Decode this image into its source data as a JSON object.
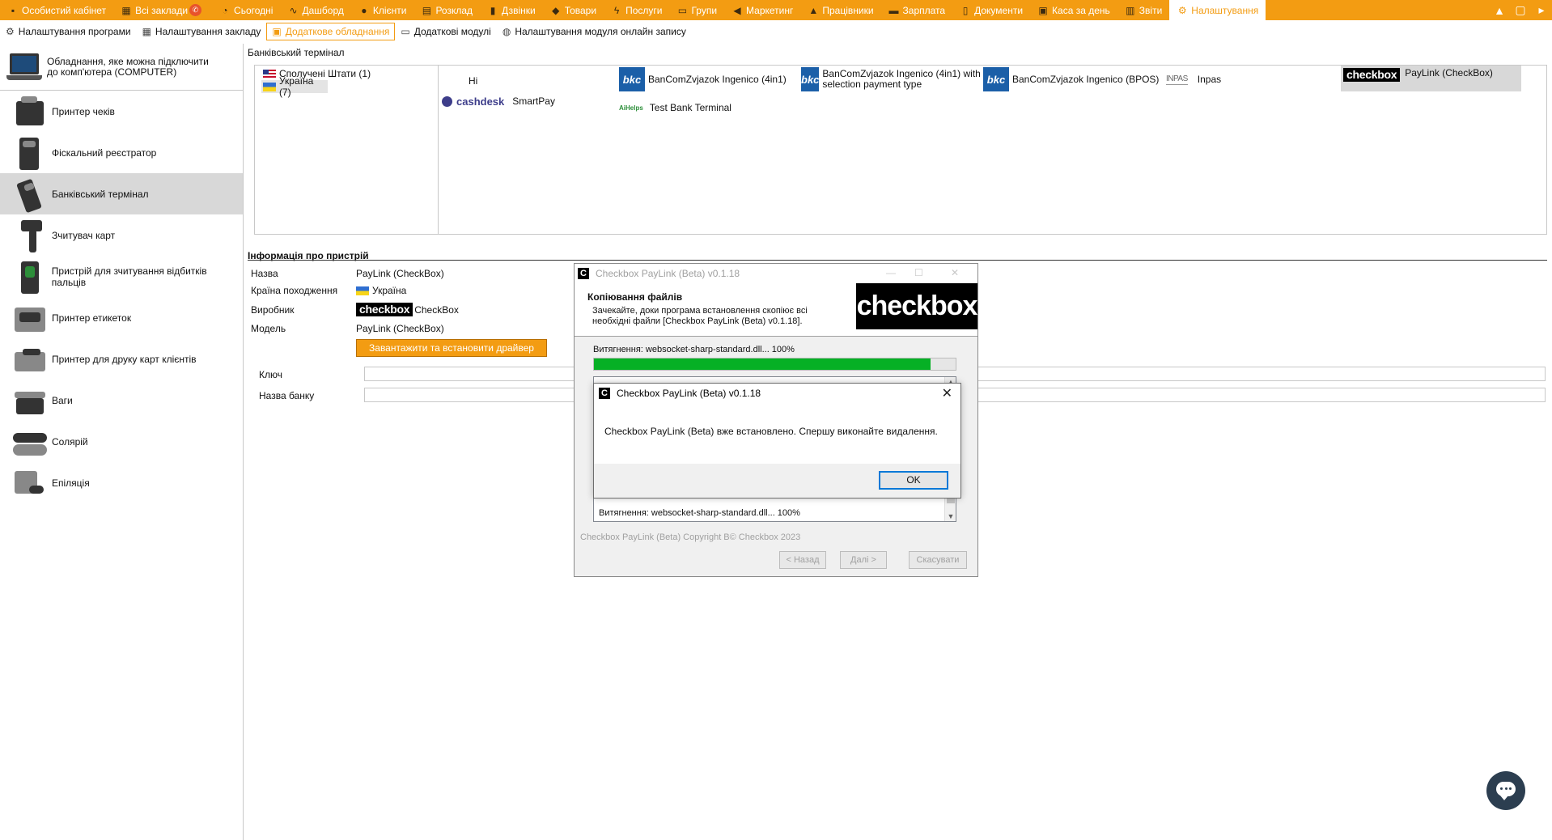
{
  "topnav": {
    "items": [
      {
        "label": "Особистий кабінет",
        "icon": "briefcase-icon"
      },
      {
        "label": "Всі заклади",
        "icon": "grid-icon"
      },
      {
        "label": "Сьогодні",
        "icon": "clock-icon"
      },
      {
        "label": "Дашборд",
        "icon": "pulse-icon"
      },
      {
        "label": "Клієнти",
        "icon": "user-icon"
      },
      {
        "label": "Розклад",
        "icon": "calendar-icon"
      },
      {
        "label": "Дзвінки",
        "icon": "phone-icon"
      },
      {
        "label": "Товари",
        "icon": "box-icon"
      },
      {
        "label": "Послуги",
        "icon": "bolt-icon"
      },
      {
        "label": "Групи",
        "icon": "folder-icon"
      },
      {
        "label": "Маркетинг",
        "icon": "megaphone-icon"
      },
      {
        "label": "Працівники",
        "icon": "person-icon"
      },
      {
        "label": "Зарплата",
        "icon": "money-icon"
      },
      {
        "label": "Документи",
        "icon": "document-icon"
      },
      {
        "label": "Каса за день",
        "icon": "calculator-icon"
      },
      {
        "label": "Звіти",
        "icon": "bar-chart-icon"
      },
      {
        "label": "Налаштування",
        "icon": "gear-icon"
      }
    ],
    "active_index": 16,
    "accent": "#f39c12"
  },
  "subnav": {
    "tabs": [
      {
        "label": "Налаштування програми",
        "icon": "gear-icon"
      },
      {
        "label": "Налаштування закладу",
        "icon": "table-icon"
      },
      {
        "label": "Додаткове обладнання",
        "icon": "printer-icon"
      },
      {
        "label": "Додаткові модулі",
        "icon": "module-icon"
      },
      {
        "label": "Налаштування модуля онлайн запису",
        "icon": "globe-icon"
      }
    ],
    "active_index": 2
  },
  "left": {
    "computer_label": "Обладнання, яке можна підключити до комп'ютера (COMPUTER)",
    "devices": [
      {
        "label": "Принтер чеків",
        "icon": "receipt-printer-icon"
      },
      {
        "label": "Фіскальний реєстратор",
        "icon": "fiscal-register-icon"
      },
      {
        "label": "Банківський термінал",
        "icon": "bank-terminal-icon"
      },
      {
        "label": "Зчитувач карт",
        "icon": "card-reader-icon"
      },
      {
        "label": "Пристрій для зчитування відбитків пальців",
        "icon": "fingerprint-reader-icon"
      },
      {
        "label": "Принтер етикеток",
        "icon": "label-printer-icon"
      },
      {
        "label": "Принтер для друку карт клієнтів",
        "icon": "card-printer-icon"
      },
      {
        "label": "Ваги",
        "icon": "scales-icon"
      },
      {
        "label": "Солярій",
        "icon": "solarium-icon"
      },
      {
        "label": "Епіляція",
        "icon": "epilation-icon"
      }
    ],
    "selected_index": 2
  },
  "main": {
    "section_title": "Банківський термінал",
    "countries": [
      {
        "label": "Сполучені Штати (1)",
        "flag": "us"
      },
      {
        "label": "Україна (7)",
        "flag": "ua"
      }
    ],
    "modules": {
      "hi": "Hi",
      "bkc1": "BanComZvjazok Ingenico (4in1)",
      "bkc2": "BanComZvjazok Ingenico (4in1) with selection payment type",
      "bkc3": "BanComZvjazok Ingenico (BPOS)",
      "inpas_logo": "INPAS",
      "inpas": "Inpas",
      "checkbox_logo": "checkbox",
      "checkbox": "PayLink (CheckBox)",
      "cashdesk_logo": "cashdesk",
      "smartpay": "SmartPay",
      "aihelps_logo": "AiHelps",
      "test": "Test Bank Terminal",
      "bkc_logo": "bkc"
    },
    "info": {
      "title": "Інформація про пристрій",
      "name_label": "Назва",
      "name_value": "PayLink (CheckBox)",
      "country_label": "Країна походження",
      "country_value": "Україна",
      "vendor_label": "Виробник",
      "vendor_logo": "checkbox",
      "vendor_value": "CheckBox",
      "model_label": "Модель",
      "model_value": "PayLink (CheckBox)",
      "driver_button": "Завантажити та встановити драйвер",
      "key_label": "Ключ",
      "bank_label": "Назва банку"
    }
  },
  "installer": {
    "title": "Checkbox PayLink (Beta) v0.1.18",
    "header_title": "Копіювання файлів",
    "header_text": "Зачекайте, доки програма встановлення скопіює всі необхідні файли [Checkbox PayLink (Beta) v0.1.18].",
    "logo_text": "checkbox",
    "progress_label": "Витягнення: websocket-sharp-standard.dll... 100%",
    "progress": 0.93,
    "log_line": "Витягнення: websocket-sharp-standard.dll... 100%",
    "copyright": "Checkbox PayLink (Beta) Copyright В© Checkbox 2023",
    "back_button": "< Назад",
    "next_button": "Далі >",
    "cancel_button": "Скасувати"
  },
  "msgbox": {
    "title": "Checkbox PayLink (Beta) v0.1.18",
    "text": "Checkbox PayLink (Beta) вже встановлено. Спершу виконайте видалення.",
    "ok_button": "OK"
  }
}
